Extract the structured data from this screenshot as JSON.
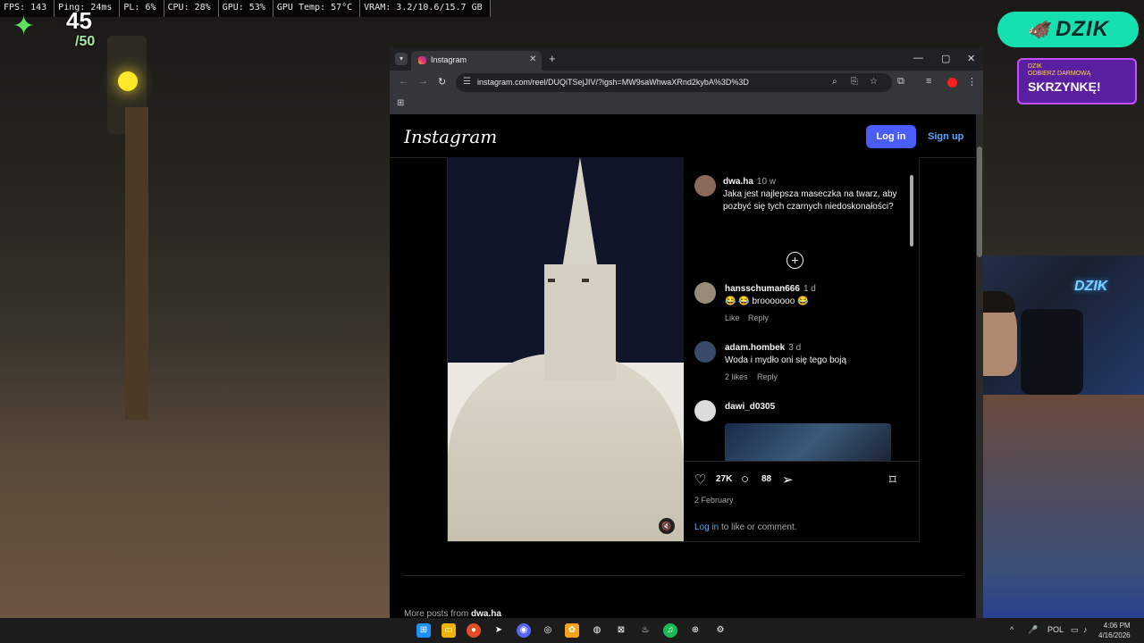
{
  "hud": {
    "fps": "FPS: 143",
    "ping": "Ping: 24ms",
    "pl": "PL: 6%",
    "cpu": "CPU: 28%",
    "gpu": "GPU: 53%",
    "gpu_temp": "GPU Temp: 57°C",
    "vram": "VRAM: 3.2/10.6/15.7 GB",
    "health_value": "45",
    "health_max": "/50"
  },
  "overlay": {
    "brand": "DZIK",
    "promo_line1": "ODBIERZ DARMOWĄ",
    "promo_line2": "SKRZYNKĘ!",
    "webcam_sign": "DZIK"
  },
  "browser": {
    "tab_title": "Instagram",
    "url": "instagram.com/reel/DUQiTSejJIV/?igsh=MW9saWhwaXRnd2kybA%3D%3D"
  },
  "instagram": {
    "logo": "Instagram",
    "login_button": "Log in",
    "signup_link": "Sign up",
    "post": {
      "author": "dwa.ha",
      "author_age": "10 w",
      "caption": "Jaka jest najlepsza maseczka na twarz, aby pozbyć się tych czarnych niedoskonałości?",
      "comments": [
        {
          "user": "hansschuman666",
          "age": "1 d",
          "text": "😂 😂 brooooooo 😂",
          "likes": "",
          "like_label": "Like",
          "reply_label": "Reply"
        },
        {
          "user": "adam.hombek",
          "age": "3 d",
          "text": "Woda i mydło oni się tego boją",
          "likes": "2 likes",
          "reply_label": "Reply"
        },
        {
          "user": "dawi_d0305",
          "age": "",
          "text": ""
        }
      ],
      "like_count": "27K",
      "comment_count": "88",
      "date": "2 February",
      "login_prompt_link": "Log in",
      "login_prompt_rest": " to like or comment."
    },
    "more_posts_prefix": "More posts from ",
    "more_posts_user": "dwa.ha"
  },
  "taskbar": {
    "lang": "POL",
    "time": "4:06 PM",
    "date": "4/16/2026"
  }
}
